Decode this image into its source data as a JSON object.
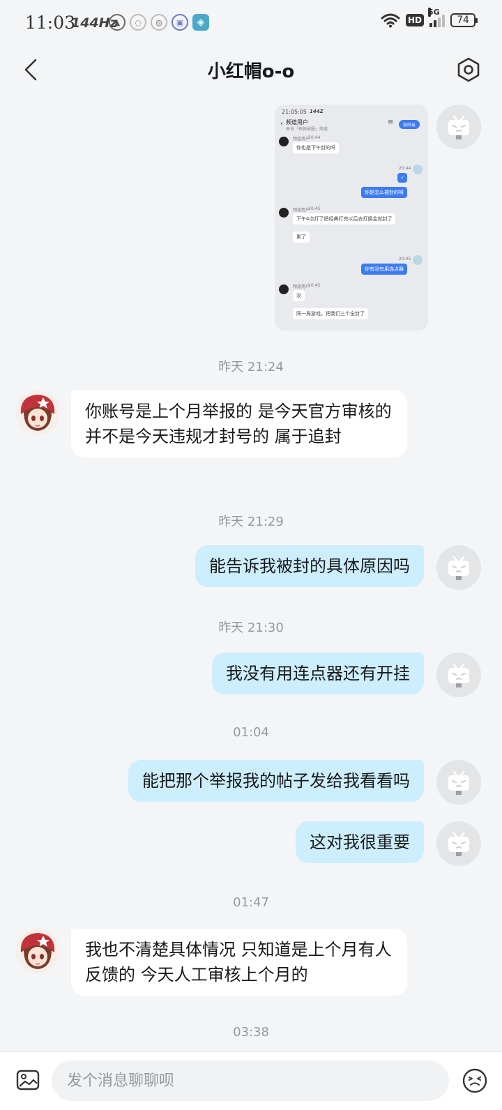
{
  "status_bar": {
    "time": "11:03",
    "refresh_rate": "144Hz",
    "battery": "74",
    "network": "5G",
    "hd": "HD"
  },
  "header": {
    "title": "小红帽o-o"
  },
  "image_message": {
    "time": "21:05:05",
    "hz": "144Z",
    "title": "频道用户",
    "subtitle": "来自「养豚破圈」频道",
    "add_friend": "加好友",
    "lines": [
      {
        "who": "other",
        "name": "频道用户",
        "time": "20:44",
        "text": "你也是下午封的吗"
      },
      {
        "who": "me",
        "time": "20:44",
        "text": "√"
      },
      {
        "who": "me",
        "text": "你是怎么被封的呀"
      },
      {
        "who": "other",
        "name": "频道用户",
        "time": "20:45",
        "text": "下午4点打了把经典打完以后去打换金就封了"
      },
      {
        "who": "other",
        "text": "累了"
      },
      {
        "who": "me",
        "time": "20:45",
        "text": "你有没有用连点器"
      },
      {
        "who": "other",
        "name": "频道用户",
        "time": "20:45",
        "text": "没"
      },
      {
        "who": "other",
        "text": "同一局游戏，把我们三个全封了"
      }
    ]
  },
  "messages": {
    "ts1": "昨天 21:24",
    "m1": "你账号是上个月举报的  是今天官方审核的  并不是今天违规才封号的  属于追封",
    "ts2": "昨天 21:29",
    "m2": "能告诉我被封的具体原因吗",
    "ts3": "昨天 21:30",
    "m3": "我没有用连点器还有开挂",
    "ts4": "01:04",
    "m4": "能把那个举报我的帖子发给我看看吗",
    "m5": "这对我很重要",
    "ts5": "01:47",
    "m6": "我也不清楚具体情况 只知道是上个月有人反馈的 今天人工审核上个月的",
    "ts6": "03:38"
  },
  "input": {
    "placeholder": "发个消息聊聊呗"
  },
  "colors": {
    "background": "#f4f5f7",
    "outgoing_bubble": "#cdeefc",
    "incoming_bubble": "#ffffff",
    "timestamp": "#9499a0"
  }
}
